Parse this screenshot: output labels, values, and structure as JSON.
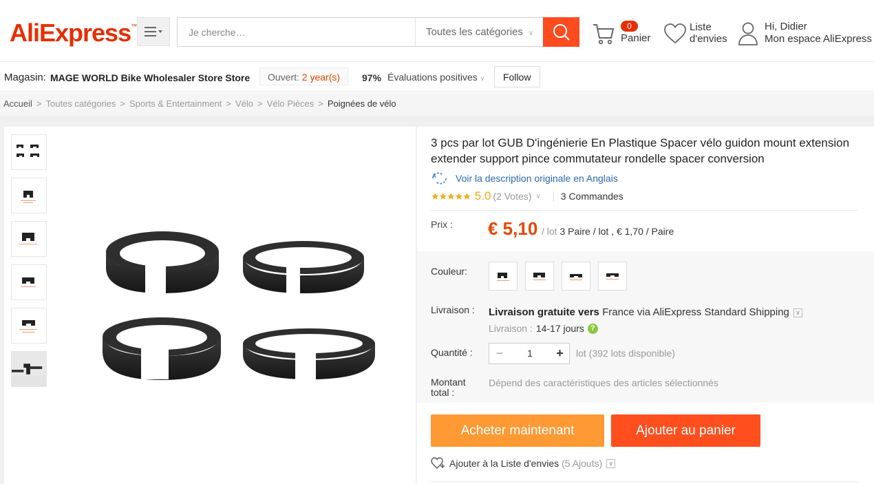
{
  "header": {
    "logo": "AliExpress",
    "search_placeholder": "Je cherche…",
    "category": "Toutes les catégories",
    "cart_count": "0",
    "cart_label": "Panier",
    "wishlist_line1": "Liste",
    "wishlist_line2": "d'envies",
    "greeting": "Hi, Didier",
    "account_label": "Mon espace AliExpress"
  },
  "store": {
    "prefix": "Magasin:",
    "name": "MAGE WORLD Bike Wholesaler Store Store",
    "open_label": "Ouvert:",
    "open_years": "2 year(s)",
    "positive_pct": "97%",
    "evaluations": "Évaluations positives",
    "follow": "Follow"
  },
  "breadcrumb": [
    "Accueil",
    "Toutes catégories",
    "Sports & Entertainment",
    "Vélo",
    "Vélo Pièces",
    "Poignées de vélo"
  ],
  "product": {
    "title": "3 pcs par lot GUB D'ingénierie En Plastique Spacer vélo guidon mount extension extender support pince commutateur rondelle spacer conversion",
    "translate_link": "Voir la description originale en Anglais",
    "stars": "★★★★★",
    "rating": "5.0",
    "votes": "(2 Votes)",
    "orders": "3 Commandes",
    "price_label": "Prix :",
    "price": "€ 5,10",
    "price_per": "/ lot",
    "price_detail": "3 Paire / lot , € 1,70 / Paire",
    "color_label": "Couleur:",
    "delivery_label": "Livraison :",
    "delivery_free": "Livraison gratuite vers",
    "delivery_dest": "France via AliExpress Standard Shipping",
    "delivery_time_label": "Livraison :",
    "delivery_days": "14-17 jours",
    "qty_label": "Quantité :",
    "qty_value": "1",
    "qty_available": "lot (392 lots disponible)",
    "total_label_1": "Montant",
    "total_label_2": "total :",
    "total_value": "Dépend des caractéristiques des articles sélectionnés",
    "buy_now": "Acheter maintenant",
    "add_to_cart": "Ajouter au panier",
    "add_wishlist": "Ajouter à la Liste d'envies",
    "wishlist_count": "(5 Ajouts)"
  },
  "colors": {
    "brand": "#e62e04",
    "search_button": "#ff4b20",
    "price": "#e64700",
    "buy_button": "#ff9933",
    "cart_button": "#ff4f1f",
    "link": "#2a6ab2",
    "stars": "#f7a711"
  }
}
